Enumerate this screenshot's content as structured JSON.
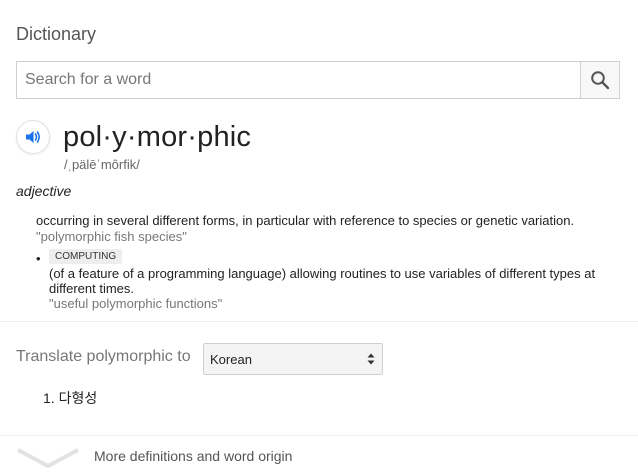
{
  "title": "Dictionary",
  "search": {
    "placeholder": "Search for a word",
    "value": "",
    "icon": "search-icon"
  },
  "entry": {
    "headword": "pol·y·mor·phic",
    "phonetic": "/ˌpälēˈmôrfik/",
    "part_of_speech": "adjective",
    "senses": [
      {
        "definition": "occurring in several different forms, in particular with reference to species or genetic variation.",
        "example": "\"polymorphic fish species\""
      },
      {
        "label": "COMPUTING",
        "definition": "(of a feature of a programming language) allowing routines to use variables of different types at different times.",
        "example": "\"useful polymorphic functions\""
      }
    ]
  },
  "translate": {
    "label": "Translate polymorphic to",
    "selected_language": "Korean",
    "results": [
      {
        "number": "1.",
        "text": "다형성"
      }
    ]
  },
  "more": {
    "label": "More definitions and word origin"
  },
  "colors": {
    "accent": "#1a73e8",
    "muted": "#777777",
    "label_bg": "#eeeeee"
  }
}
